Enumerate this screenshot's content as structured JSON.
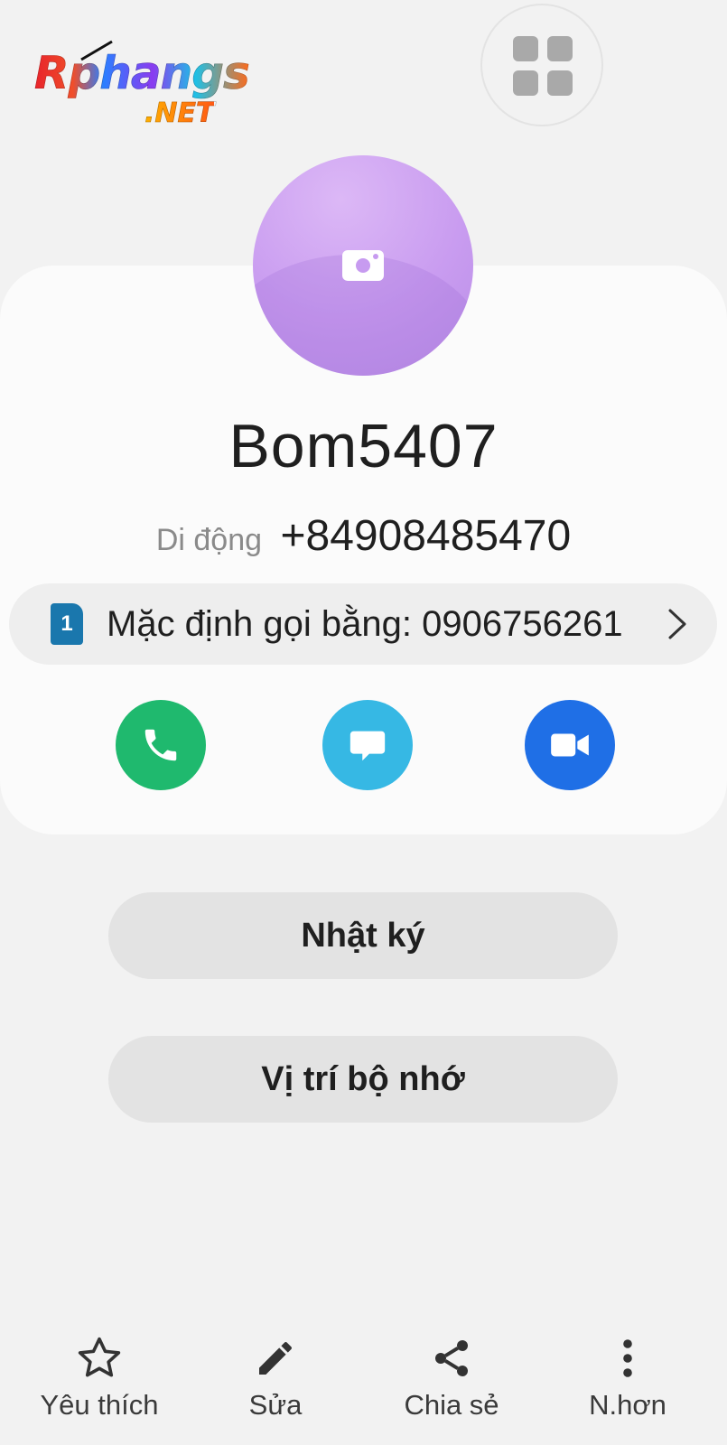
{
  "watermark": {
    "logo_main": "Rphangs",
    "logo_sub": ".NET"
  },
  "header": {
    "grid_icon": "apps-grid-icon"
  },
  "contact": {
    "avatar_icon": "camera-icon",
    "name": "Bom5407",
    "phone_label": "Di động",
    "phone_number": "+84908485470",
    "default_call": {
      "sim_number": "1",
      "text": "Mặc định gọi bằng: 0906756261"
    }
  },
  "actions": {
    "call_icon": "phone-icon",
    "message_icon": "message-icon",
    "video_icon": "video-camera-icon",
    "colors": {
      "call": "#1fb96e",
      "message": "#36b8e4",
      "video": "#1f6fe6"
    }
  },
  "buttons": {
    "history": "Nhật ký",
    "storage": "Vị trí bộ nhớ"
  },
  "bottom_nav": [
    {
      "label": "Yêu thích",
      "icon": "star-icon"
    },
    {
      "label": "Sửa",
      "icon": "pencil-icon"
    },
    {
      "label": "Chia sẻ",
      "icon": "share-icon"
    },
    {
      "label": "N.hơn",
      "icon": "more-vertical-icon"
    }
  ]
}
